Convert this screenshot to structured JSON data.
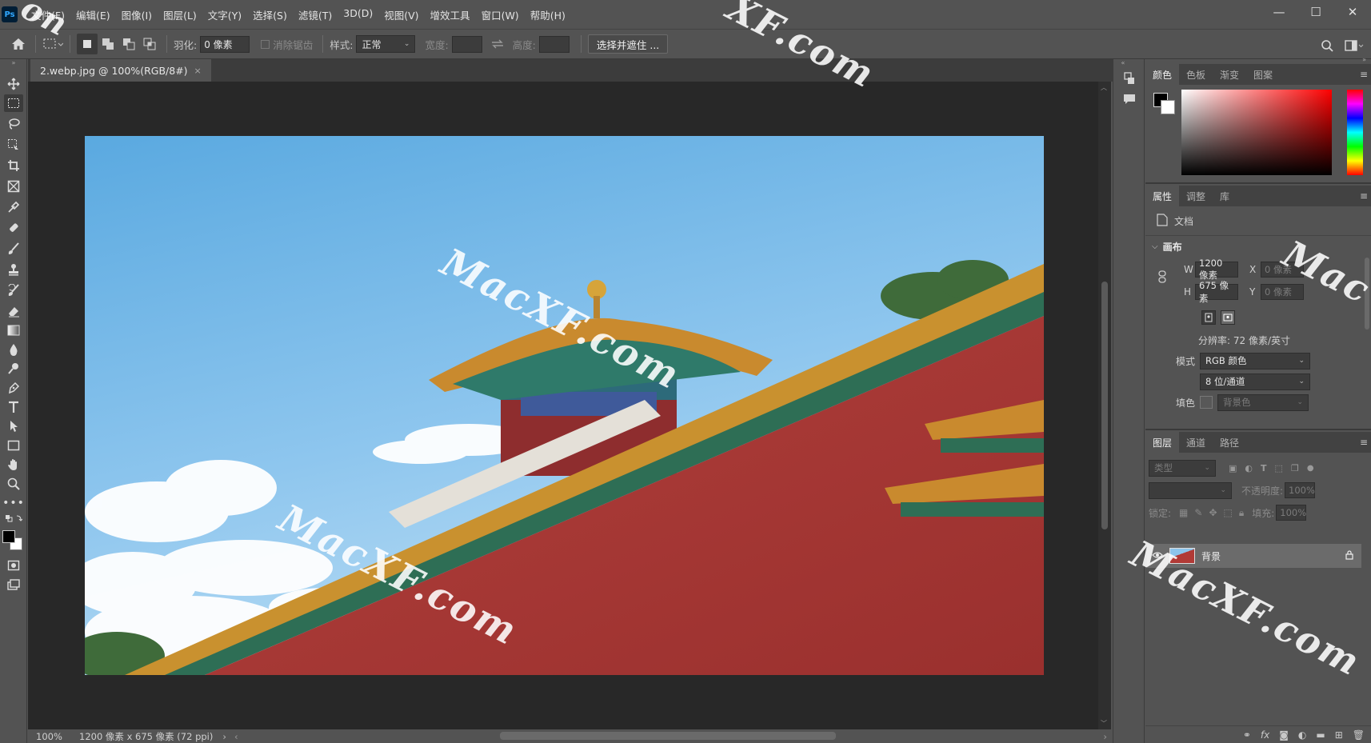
{
  "app": {
    "logo": "Ps"
  },
  "menu": [
    "文件(F)",
    "编辑(E)",
    "图像(I)",
    "图层(L)",
    "文字(Y)",
    "选择(S)",
    "滤镜(T)",
    "3D(D)",
    "视图(V)",
    "增效工具",
    "窗口(W)",
    "帮助(H)"
  ],
  "window_controls": {
    "minimize": "—",
    "maximize": "☐",
    "close": "✕"
  },
  "options": {
    "feather_label": "羽化:",
    "feather_value": "0 像素",
    "antialias_label": "消除锯齿",
    "style_label": "样式:",
    "style_value": "正常",
    "width_label": "宽度:",
    "height_label": "高度:",
    "select_mask_button": "选择并遮住 ..."
  },
  "document": {
    "tab_title": "2.webp.jpg @ 100%(RGB/8#)",
    "tab_close": "×",
    "zoom": "100%",
    "doc_info": "1200 像素 x 675 像素 (72 ppi)"
  },
  "panels": {
    "color": {
      "tabs": [
        "颜色",
        "色板",
        "渐变",
        "图案"
      ]
    },
    "properties": {
      "tabs": [
        "属性",
        "调整",
        "库"
      ],
      "doc_label": "文档",
      "canvas_section": "画布",
      "w_label": "W",
      "w_value": "1200 像素",
      "h_label": "H",
      "h_value": "675 像素",
      "x_label": "X",
      "x_value": "0 像素",
      "y_label": "Y",
      "y_value": "0 像素",
      "resolution": "分辨率: 72 像素/英寸",
      "mode_label": "模式",
      "mode_value": "RGB 颜色",
      "depth_value": "8 位/通道",
      "fill_label": "填色",
      "fill_value": "背景色"
    },
    "layers": {
      "tabs": [
        "图层",
        "通道",
        "路径"
      ],
      "filter_placeholder": "类型",
      "opacity_label": "不透明度:",
      "opacity_value": "100%",
      "lock_label": "锁定:",
      "fill_label": "填充:",
      "fill_value": "100%",
      "layer_name": "背景"
    }
  },
  "watermarks": [
    "MacXF.com",
    "MacXF.com",
    "MacXF.com",
    "XF.com",
    "Mac",
    "on"
  ]
}
